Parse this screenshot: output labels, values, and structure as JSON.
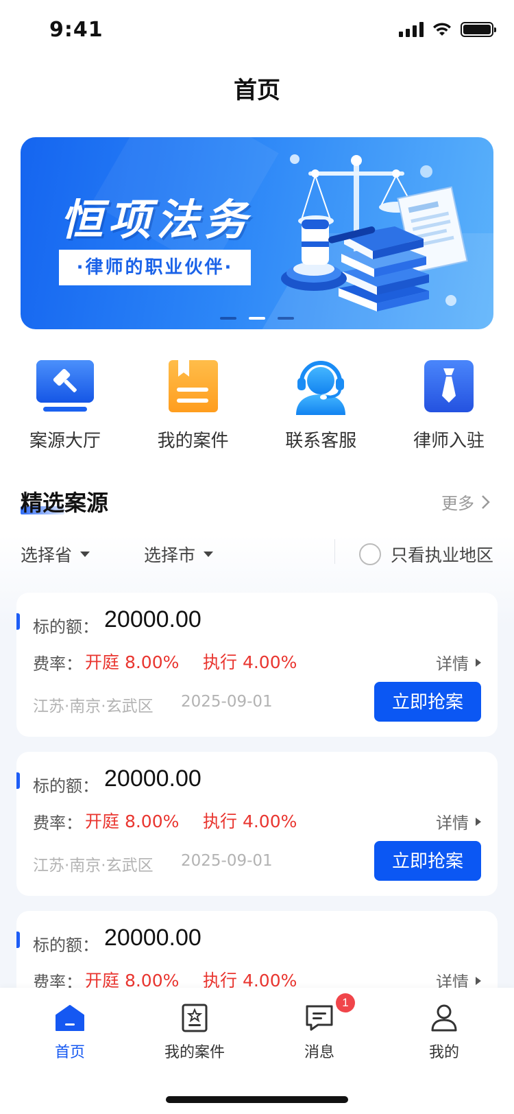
{
  "status_bar": {
    "time": "9:41"
  },
  "header": {
    "title": "首页"
  },
  "banner": {
    "title": "恒项法务",
    "subtitle": "·律师的职业伙伴·",
    "slides": 3,
    "active_slide": 2
  },
  "quick_nav": [
    {
      "label": "案源大厅",
      "icon": "gavel-screen-icon"
    },
    {
      "label": "我的案件",
      "icon": "case-folder-icon"
    },
    {
      "label": "联系客服",
      "icon": "headset-service-icon"
    },
    {
      "label": "律师入驻",
      "icon": "lawyer-tie-icon"
    }
  ],
  "section": {
    "title": "精选案源",
    "more": "更多"
  },
  "filters": {
    "province": "选择省",
    "city": "选择市",
    "only_region": "只看执业地区"
  },
  "cards": [
    {
      "amount_label": "标的额：",
      "amount": "20000.00",
      "rate_label": "费率：",
      "rate_court": "开庭 8.00%",
      "rate_exec": "执行 4.00%",
      "detail": "详情",
      "region": "江苏·南京·玄武区",
      "date": "2025-09-01",
      "action": "立即抢案"
    },
    {
      "amount_label": "标的额：",
      "amount": "20000.00",
      "rate_label": "费率：",
      "rate_court": "开庭 8.00%",
      "rate_exec": "执行 4.00%",
      "detail": "详情",
      "region": "江苏·南京·玄武区",
      "date": "2025-09-01",
      "action": "立即抢案"
    },
    {
      "amount_label": "标的额：",
      "amount": "20000.00",
      "rate_label": "费率：",
      "rate_court": "开庭 8.00%",
      "rate_exec": "执行 4.00%",
      "detail": "详情"
    }
  ],
  "tab_bar": [
    {
      "label": "首页",
      "icon": "home-icon",
      "active": true
    },
    {
      "label": "我的案件",
      "icon": "case-icon"
    },
    {
      "label": "消息",
      "icon": "message-icon",
      "badge": "1"
    },
    {
      "label": "我的",
      "icon": "user-icon"
    }
  ],
  "colors": {
    "primary": "#0b57f3",
    "rate_red": "#e9352f",
    "muted": "#b3b3b3"
  }
}
